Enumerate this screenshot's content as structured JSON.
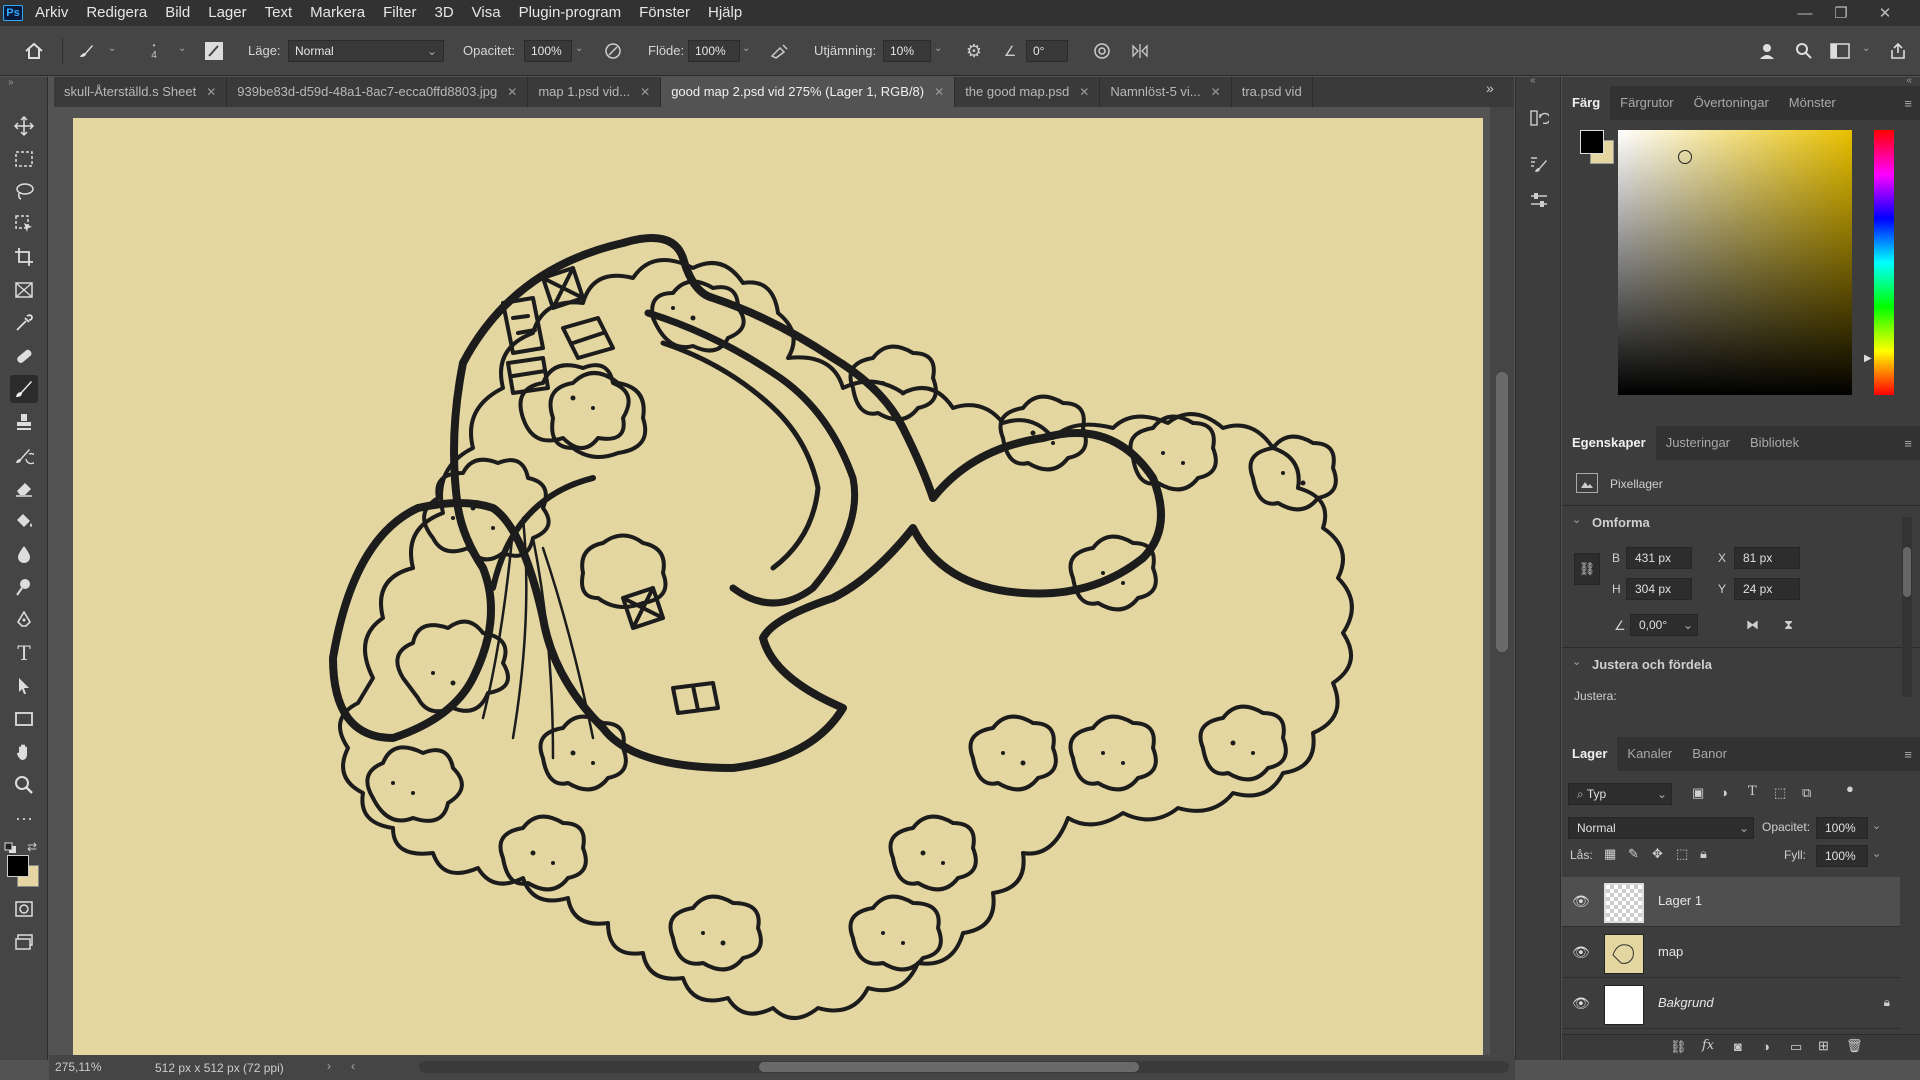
{
  "app": {
    "logo": "Ps"
  },
  "menu": [
    "Arkiv",
    "Redigera",
    "Bild",
    "Lager",
    "Text",
    "Markera",
    "Filter",
    "3D",
    "Visa",
    "Plugin-program",
    "Fönster",
    "Hjälp"
  ],
  "options": {
    "brush_size": "4",
    "mode_label": "Läge:",
    "mode_value": "Normal",
    "opacity_label": "Opacitet:",
    "opacity_value": "100%",
    "flow_label": "Flöde:",
    "flow_value": "100%",
    "smoothing_label": "Utjämning:",
    "smoothing_value": "10%",
    "angle_value": "0°"
  },
  "tabs": [
    {
      "label": "skull-Återställd.s Sheet",
      "active": false
    },
    {
      "label": "939be83d-d59d-48a1-8ac7-ecca0ffd8803.jpg",
      "active": false
    },
    {
      "label": "map 1.psd vid...",
      "active": false
    },
    {
      "label": "good map 2.psd vid 275% (Lager 1, RGB/8)",
      "active": true
    },
    {
      "label": "the good map.psd",
      "active": false
    },
    {
      "label": "Namnlöst-5 vi...",
      "active": false
    },
    {
      "label": "tra.psd vid",
      "active": false
    }
  ],
  "status": {
    "zoom": "275,11%",
    "doc_info": "512 px x 512 px (72 ppi)"
  },
  "color_panel": {
    "tabs": [
      "Färg",
      "Färgrutor",
      "Övertoningar",
      "Mönster"
    ],
    "foreground": "#000000",
    "background": "#e4d6a0",
    "hue_color": "#e8c000"
  },
  "properties": {
    "tabs": [
      "Egenskaper",
      "Justeringar",
      "Bibliotek"
    ],
    "layer_type": "Pixellager",
    "transform_title": "Omforma",
    "w_label": "B",
    "w_value": "431 px",
    "h_label": "H",
    "h_value": "304 px",
    "x_label": "X",
    "x_value": "81 px",
    "y_label": "Y",
    "y_value": "24 px",
    "angle_value": "0,00°",
    "align_title": "Justera och fördela",
    "align_label": "Justera:"
  },
  "layers": {
    "tabs": [
      "Lager",
      "Kanaler",
      "Banor"
    ],
    "filter_label": "Typ",
    "blend_mode": "Normal",
    "opacity_label": "Opacitet:",
    "opacity_value": "100%",
    "lock_label": "Lås:",
    "fill_label": "Fyll:",
    "fill_value": "100%",
    "items": [
      {
        "name": "Lager 1",
        "selected": true
      },
      {
        "name": "map",
        "selected": false
      },
      {
        "name": "Bakgrund",
        "selected": false
      }
    ]
  }
}
